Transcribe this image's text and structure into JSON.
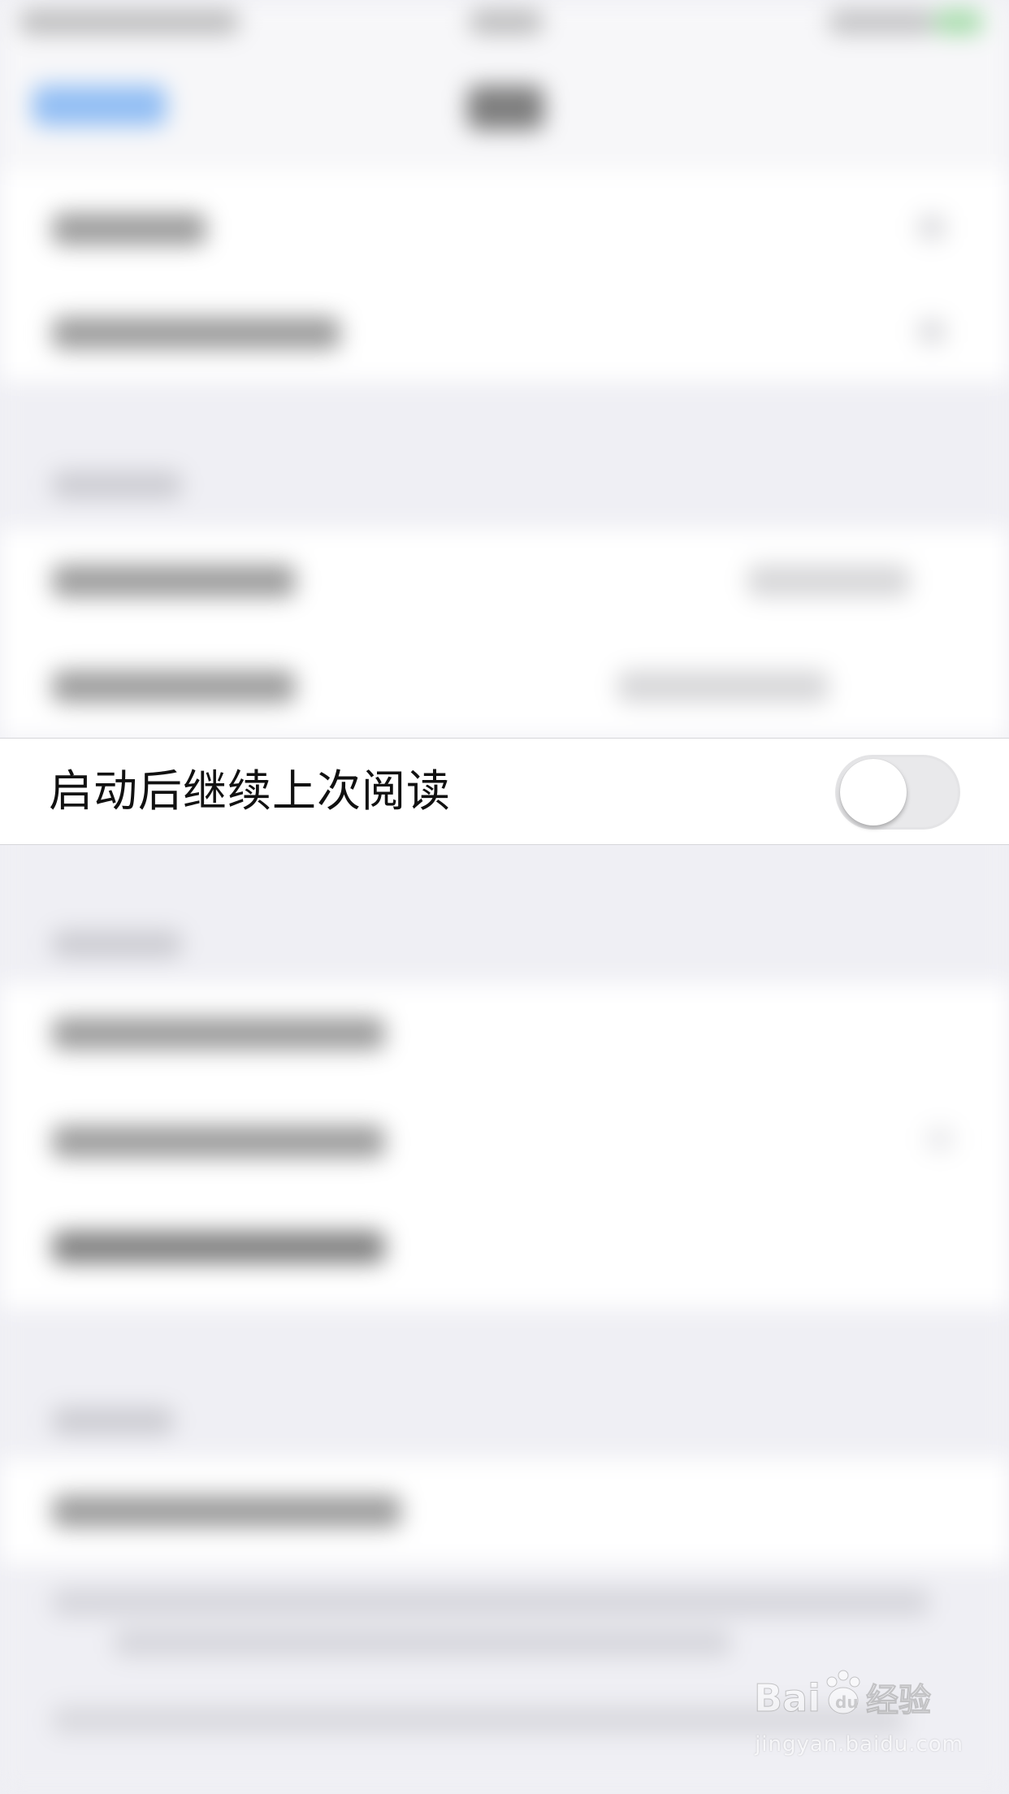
{
  "setting_row": {
    "label": "启动后继续上次阅读",
    "toggle_on": false
  },
  "watermark": {
    "brand": "Baidu经验",
    "url": "jingyan.baidu.com"
  },
  "colors": {
    "background": "#efeff4",
    "cell": "#ffffff",
    "toggle_off": "#e9e9eb"
  }
}
